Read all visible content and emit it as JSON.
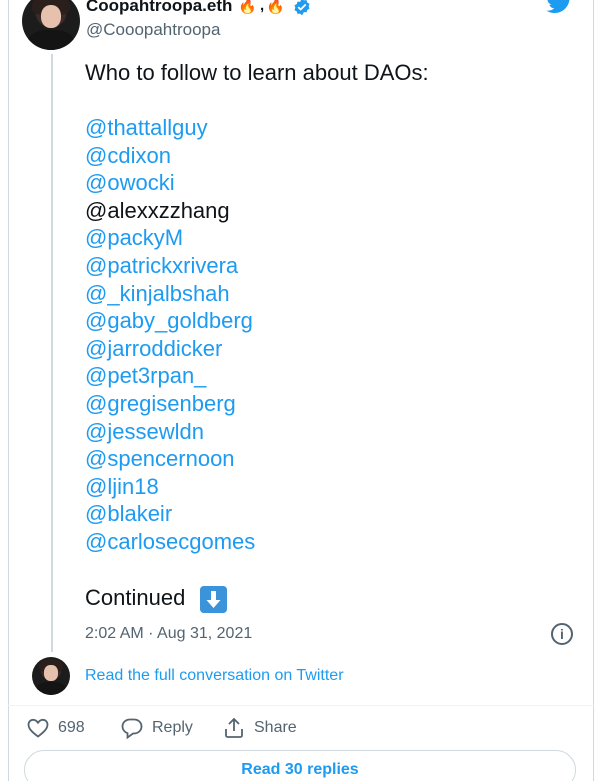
{
  "tweet": {
    "display_name": "Coopahtroopa.eth",
    "name_emoji_1": "🔥",
    "name_emoji_sep": ",",
    "name_emoji_2": "🔥",
    "handle": "@Cooopahtroopa",
    "text": "Who to follow to learn about DAOs:",
    "mentions": [
      {
        "text": "@thattallguy",
        "linked": true
      },
      {
        "text": "@cdixon",
        "linked": true
      },
      {
        "text": "@owocki",
        "linked": true
      },
      {
        "text": "@alexxzzhang",
        "linked": false
      },
      {
        "text": "@packyM",
        "linked": true
      },
      {
        "text": "@patrickxrivera",
        "linked": true
      },
      {
        "text": "@_kinjalbshah",
        "linked": true
      },
      {
        "text": "@gaby_goldberg",
        "linked": true
      },
      {
        "text": "@jarroddicker",
        "linked": true
      },
      {
        "text": "@pet3rpan_",
        "linked": true
      },
      {
        "text": "@gregisenberg",
        "linked": true
      },
      {
        "text": "@jessewldn",
        "linked": true
      },
      {
        "text": "@spencernoon",
        "linked": true
      },
      {
        "text": "@ljin18",
        "linked": true
      },
      {
        "text": "@blakeir",
        "linked": true
      },
      {
        "text": "@carlosecgomes",
        "linked": true
      }
    ],
    "continued": "Continued",
    "continued_icon": "down-arrow-icon",
    "timestamp": "2:02 AM · Aug 31, 2021",
    "info_icon": "i"
  },
  "conversation": {
    "link": "Read the full conversation on Twitter"
  },
  "actions": {
    "likes": "698",
    "reply": "Reply",
    "share": "Share"
  },
  "replies_button": "Read 30 replies",
  "colors": {
    "link": "#1d9bf0",
    "text": "#0f1419",
    "muted": "#536471",
    "border": "#cfd9de"
  }
}
